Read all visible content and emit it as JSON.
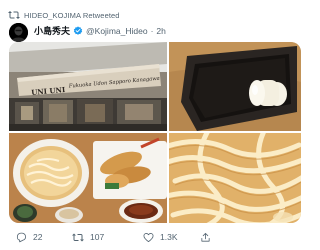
{
  "retweet": {
    "icon": "retweet-icon",
    "label": "HIDEO_KOJIMA Retweeted"
  },
  "author": {
    "display_name": "小島秀夫",
    "handle": "@Kojima_Hideo",
    "separator": "·",
    "time": "2h",
    "verified": true,
    "verified_color": "#1d9bf0"
  },
  "media": [
    {
      "id": "storefront-photo",
      "sign_text": "UNI UNI  Fukuoka Udon Sapporo Kanagawa",
      "sign_left": "UNI UNI"
    },
    {
      "id": "butter-dish-photo"
    },
    {
      "id": "udon-tempura-set-photo"
    },
    {
      "id": "udon-noodles-closeup-photo"
    }
  ],
  "actions": {
    "reply": {
      "icon": "reply-icon",
      "count": "22"
    },
    "retweet": {
      "icon": "retweet-icon",
      "count": "107"
    },
    "like": {
      "icon": "heart-icon",
      "count": "1.3K"
    },
    "share": {
      "icon": "share-icon",
      "count": ""
    }
  },
  "colors": {
    "text_secondary": "#536471",
    "text_primary": "#0f1419",
    "verified": "#1d9bf0"
  }
}
